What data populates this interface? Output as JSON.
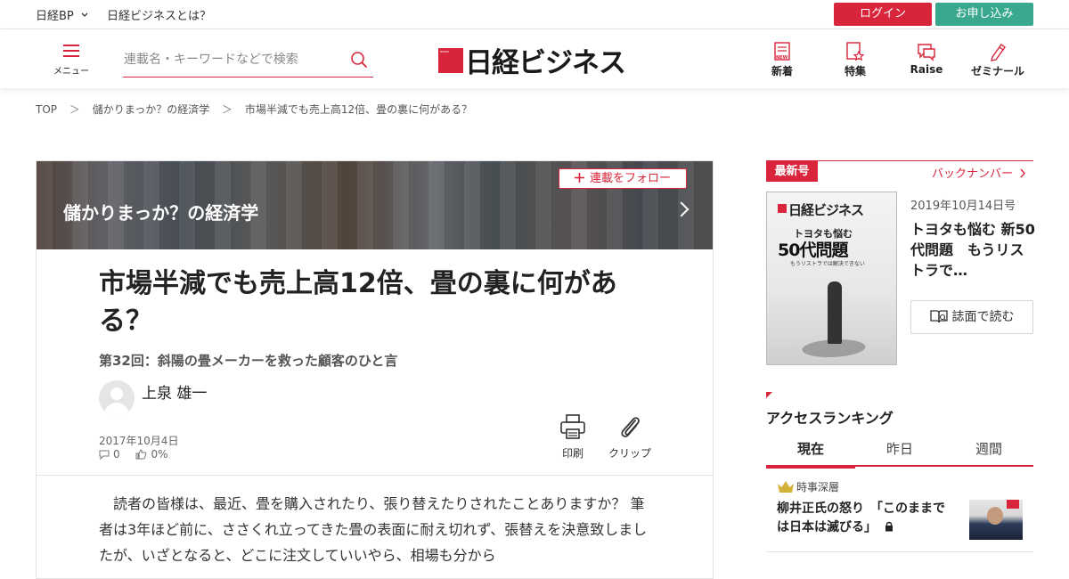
{
  "topbar": {
    "brand": "日経BP",
    "about": "日経ビジネスとは？",
    "login": "ログイン",
    "apply": "お申し込み"
  },
  "header": {
    "menu_label": "メニュー",
    "search_placeholder": "連載名・キーワードなどで検索",
    "logo_text": "日経ビジネス",
    "nav": [
      {
        "label": "新着",
        "icon": "new-icon"
      },
      {
        "label": "特集",
        "icon": "feature-icon"
      },
      {
        "label": "Raise",
        "icon": "raise-icon"
      },
      {
        "label": "ゼミナール",
        "icon": "seminar-icon"
      }
    ]
  },
  "breadcrumb": {
    "items": [
      "TOP",
      "儲かりまっか？の経済学",
      "市場半減でも売上高12倍、畳の裏に何がある？"
    ],
    "separator": "＞"
  },
  "article": {
    "series": "儲かりまっか？の経済学",
    "follow_label": "連載をフォロー",
    "title": "市場半減でも売上高12倍、畳の裏に何がある？",
    "subtitle": "第32回：斜陽の畳メーカーを救った顧客のひと言",
    "author": "上泉 雄一",
    "date": "2017年10月4日",
    "comments": "0",
    "likes": "0%",
    "print_label": "印刷",
    "clip_label": "クリップ",
    "body": "読者の皆様は、最近、畳を購入されたり、張り替えたりされたことありますか？ 筆者は3年ほど前に、ささくれ立ってきた畳の表面に耐え切れず、張替えを決意致しましたが、いざとなると、どこに注文していいやら、相場も分から"
  },
  "sidebar": {
    "latest_label": "最新号",
    "backnumber_label": "バックナンバー",
    "cover_logo": "日経ビジネス",
    "cover_headline_small": "トヨタも悩む",
    "cover_headline": "50代問題",
    "cover_subline": "もうリストラでは解決できない",
    "issue_date": "2019年10月14日号",
    "issue_title": "トヨタも悩む 新50代問題　もうリストラで…",
    "read_label": "誌面で読む",
    "ranking_title": "アクセスランキング",
    "tabs": [
      "現在",
      "昨日",
      "週間"
    ],
    "rank_item": {
      "category": "時事深層",
      "headline": "柳井正氏の怒り　「このままでは日本は滅びる」"
    }
  },
  "colors": {
    "accent": "#d9253b",
    "apply": "#3aa88f"
  }
}
